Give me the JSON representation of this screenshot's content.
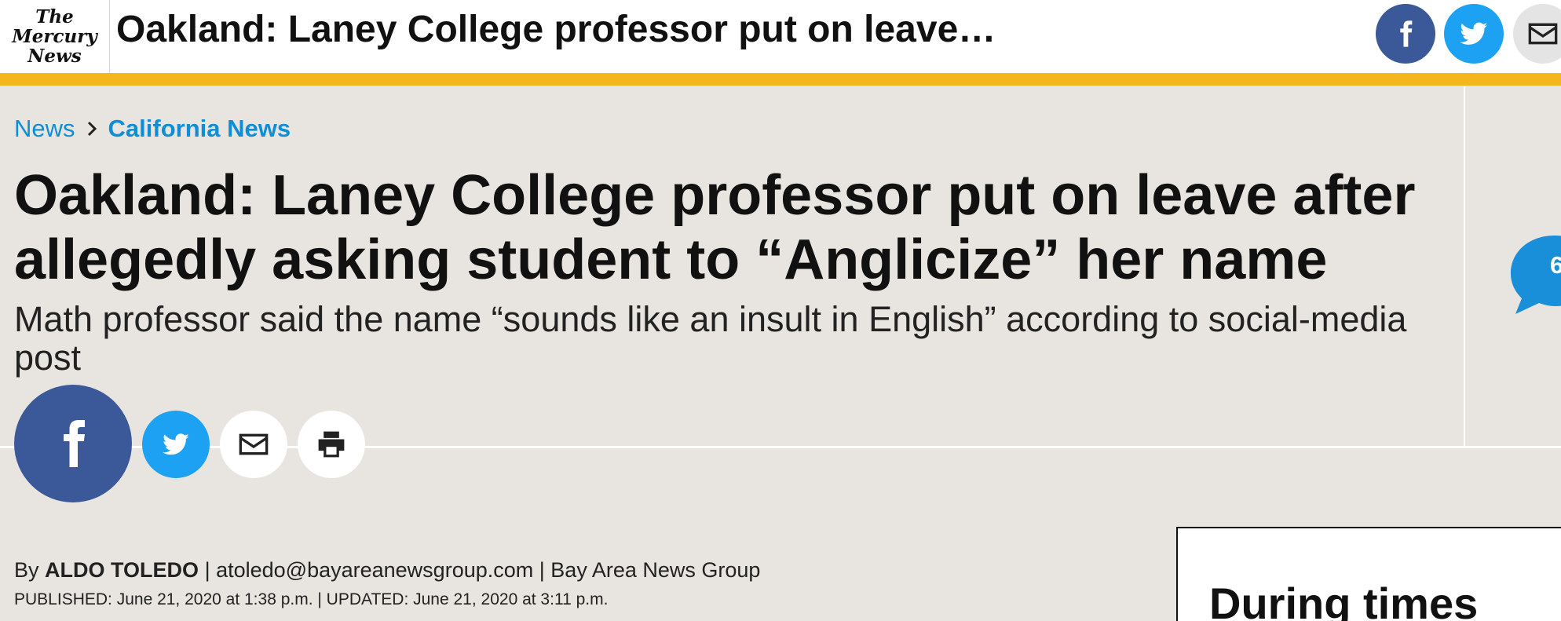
{
  "header": {
    "logo_lines": [
      "The",
      "Mercury",
      "News"
    ],
    "title": "Oakland: Laney College professor put on leave…",
    "share_icons": [
      "facebook-icon",
      "twitter-icon",
      "email-icon"
    ]
  },
  "breadcrumb": {
    "section": "News",
    "category": "California News"
  },
  "article": {
    "headline": "Oakland: Laney College professor put on leave after allegedly asking student to “Anglicize” her name",
    "subhead": "Math professor said the name “sounds like an insult in English” according to social-media post",
    "comment_count": "6",
    "byline": {
      "prefix": "By",
      "author": "ALDO TOLEDO",
      "email": "atoledo@bayareanewsgroup.com",
      "org": "Bay Area News Group",
      "separator": "|"
    },
    "dateline": "PUBLISHED: June 21, 2020 at 1:38 p.m. | UPDATED: June 21, 2020 at 3:11 p.m."
  },
  "share_bar": [
    "facebook-icon",
    "twitter-icon",
    "email-icon",
    "print-icon"
  ],
  "ad": {
    "text": "During times"
  },
  "colors": {
    "accent_yellow": "#f3b71b",
    "link_blue": "#0f8ed6",
    "facebook": "#3b5998",
    "twitter": "#1da1f2",
    "background": "#e8e5e1"
  }
}
